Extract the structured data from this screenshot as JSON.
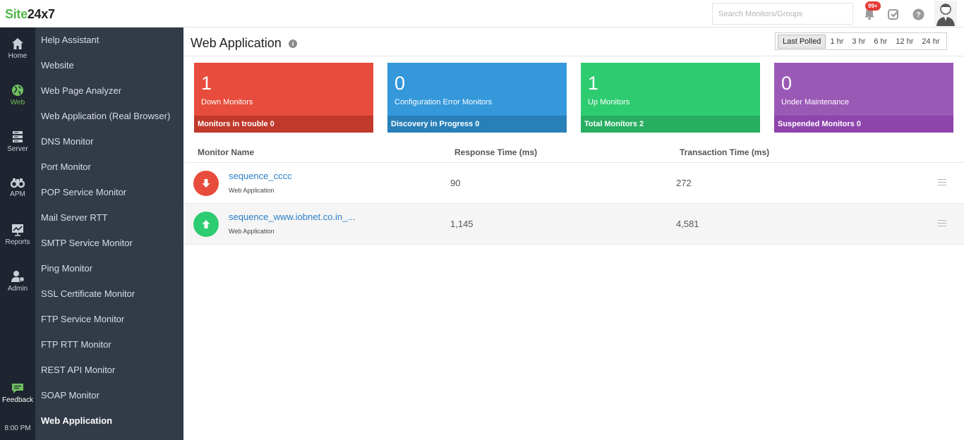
{
  "brand": {
    "part1": "Site",
    "part2": "24x7"
  },
  "search": {
    "placeholder": "Search Monitors/Groups"
  },
  "notifications": {
    "badge": "99+"
  },
  "rail": [
    {
      "label": "Home",
      "icon": "home-icon"
    },
    {
      "label": "Web",
      "icon": "globe-icon"
    },
    {
      "label": "Server",
      "icon": "server-icon"
    },
    {
      "label": "APM",
      "icon": "binoculars-icon"
    },
    {
      "label": "Reports",
      "icon": "chart-icon"
    },
    {
      "label": "Admin",
      "icon": "admin-icon"
    },
    {
      "label": "Feedback",
      "icon": "feedback-icon"
    }
  ],
  "clock": "8:00 PM",
  "subnav": [
    "Help Assistant",
    "Website",
    "Web Page Analyzer",
    "Web Application (Real Browser)",
    "DNS Monitor",
    "Port Monitor",
    "POP Service Monitor",
    "Mail Server RTT",
    "SMTP Service Monitor",
    "Ping Monitor",
    "SSL Certificate Monitor",
    "FTP Service Monitor",
    "FTP RTT Monitor",
    "REST API Monitor",
    "SOAP Monitor",
    "Web Application"
  ],
  "page": {
    "title": "Web Application",
    "info_icon": "i"
  },
  "time_range": {
    "options": [
      "Last Polled",
      "1 hr",
      "3 hr",
      "6 hr",
      "12 hr",
      "24 hr"
    ],
    "selected": "Last Polled"
  },
  "cards": [
    {
      "count": "1",
      "label": "Down Monitors",
      "footer_label": "Monitors in trouble",
      "footer_count": "0",
      "color": "#e74c3c",
      "footer_color": "#c0392b"
    },
    {
      "count": "0",
      "label": "Configuration Error Monitors",
      "footer_label": "Discovery in Progress",
      "footer_count": "0",
      "color": "#3498db",
      "footer_color": "#2980b9"
    },
    {
      "count": "1",
      "label": "Up Monitors",
      "footer_label": "Total Monitors",
      "footer_count": "2",
      "color": "#2ecc71",
      "footer_color": "#27ae60"
    },
    {
      "count": "0",
      "label": "Under Maintenance",
      "footer_label": "Suspended Monitors",
      "footer_count": "0",
      "color": "#9b59b6",
      "footer_color": "#8e44ad"
    }
  ],
  "table": {
    "columns": [
      "Monitor Name",
      "Response Time (ms)",
      "Transaction Time (ms)"
    ],
    "rows": [
      {
        "status": "down",
        "name": "sequence_cccc",
        "type": "Web Application",
        "response": "90",
        "transaction": "272"
      },
      {
        "status": "up",
        "name": "sequence_www.iobnet.co.in_...",
        "type": "Web Application",
        "response": "1,145",
        "transaction": "4,581"
      }
    ]
  },
  "colors": {
    "down": "#e74c3c",
    "up": "#2ecc71",
    "link": "#2a7fc9",
    "active_nav": "#6fc05f"
  }
}
